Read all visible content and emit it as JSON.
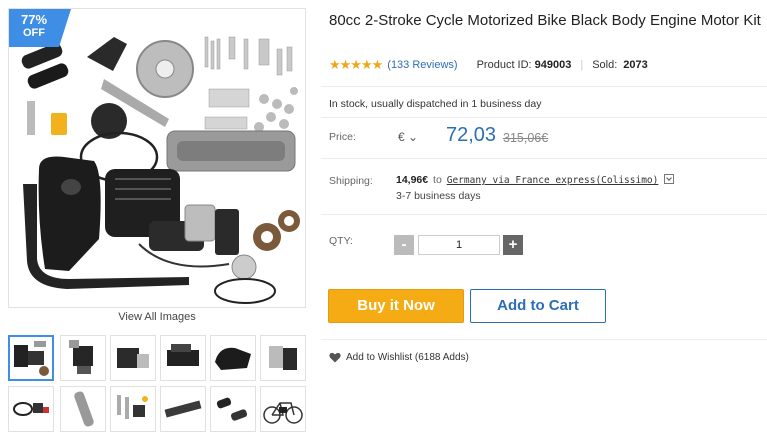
{
  "gallery": {
    "badge_percent": "77%",
    "badge_off": "OFF",
    "view_all": "View All Images",
    "thumbnails": [
      "thumb-engine-kit",
      "thumb-engine-side",
      "thumb-engine-block",
      "thumb-engine-top",
      "thumb-fuel-tank",
      "thumb-carburetor",
      "thumb-cables",
      "thumb-chain",
      "thumb-parts",
      "thumb-exhaust",
      "thumb-grips",
      "thumb-bicycle"
    ]
  },
  "product": {
    "title": "80cc 2-Stroke Cycle Motorized Bike Black Body Engine Motor Kit",
    "stars": "★★★★★",
    "rating": 4.5,
    "reviews": "(133 Reviews)",
    "product_id_label": "Product ID:",
    "product_id": "949003",
    "sold_label": "Sold:",
    "sold": "2073",
    "stock": "In stock, usually dispatched in 1 business day",
    "price_label": "Price:",
    "currency": "€ ⌄",
    "price": "72,03",
    "old_price": "315,06€",
    "shipping_label": "Shipping:",
    "shipping_price": "14,96€",
    "shipping_to": "to",
    "shipping_method": "Germany via France express(Colissimo)",
    "shipping_days": "3-7 business days",
    "qty_label": "QTY:",
    "qty_value": "1",
    "qty_minus": "-",
    "qty_plus": "+",
    "buy_now": "Buy it Now",
    "add_to_cart": "Add to Cart",
    "wishlist": "Add to Wishlist (6188 Adds)"
  },
  "colors": {
    "accent_blue": "#2d6fb5",
    "badge_blue": "#3d8ee4",
    "buy_orange": "#f5ab14",
    "star_gold": "#f0a81a"
  }
}
